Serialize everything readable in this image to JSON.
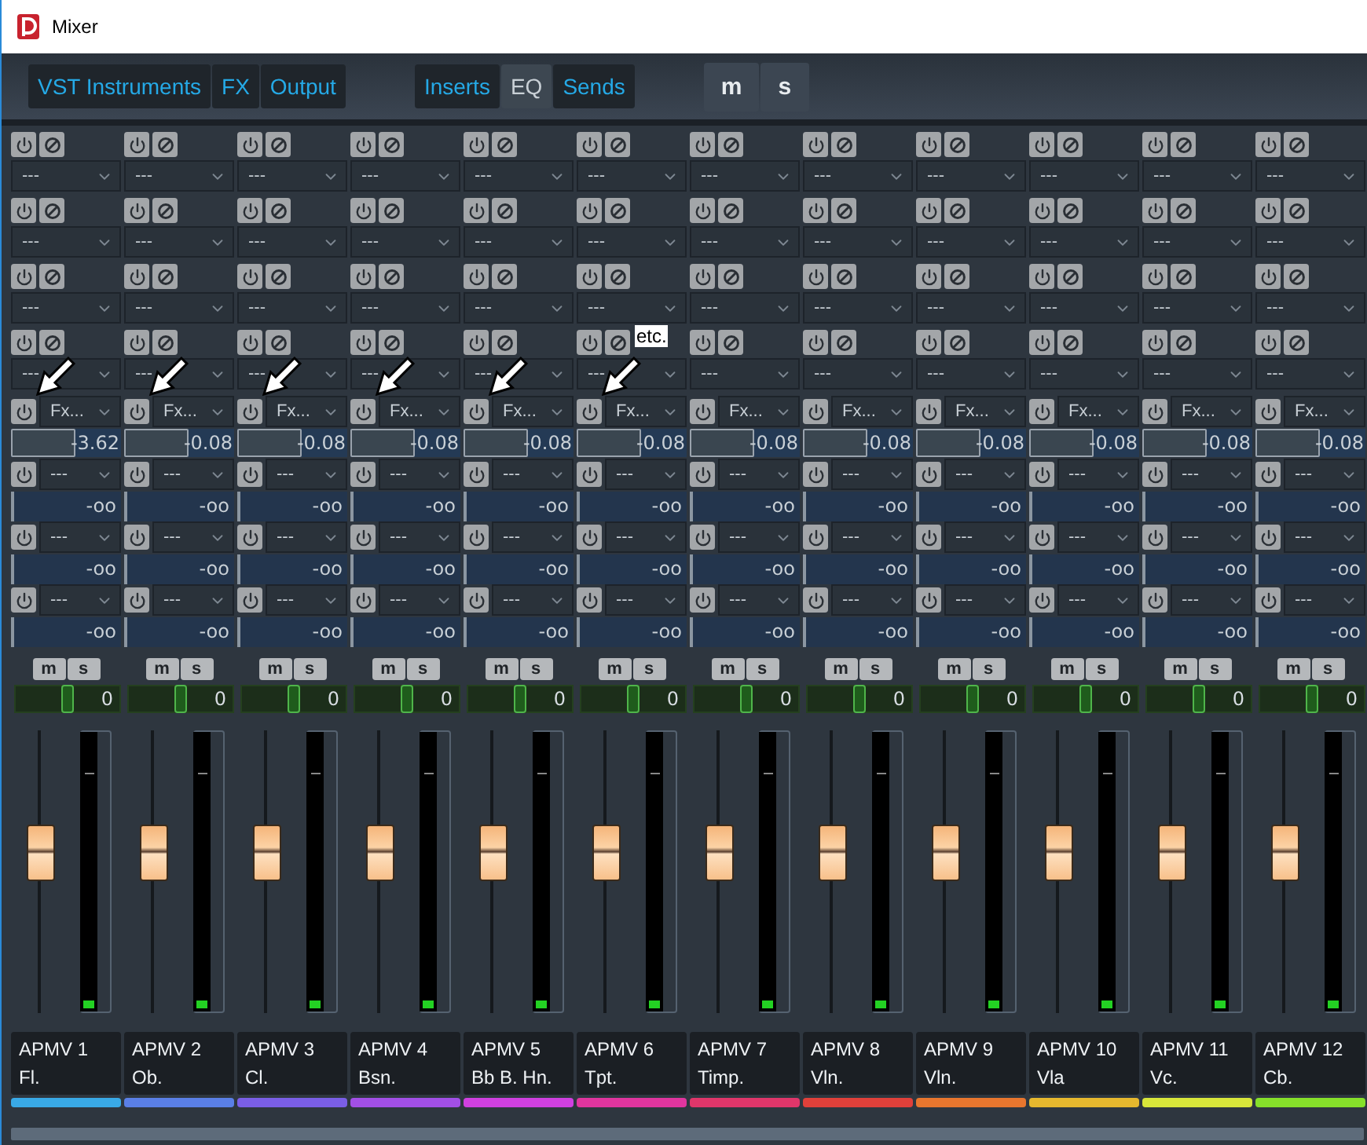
{
  "window": {
    "title": "Mixer"
  },
  "toolbar": {
    "groups": [
      [
        {
          "label": "VST Instruments",
          "selected": false
        },
        {
          "label": "FX",
          "selected": false
        },
        {
          "label": "Output",
          "selected": false
        }
      ],
      [
        {
          "label": "Inserts",
          "selected": false
        },
        {
          "label": "EQ",
          "selected": true
        },
        {
          "label": "Sends",
          "selected": false
        }
      ],
      [
        {
          "label": "m",
          "selected": false
        },
        {
          "label": "s",
          "selected": false
        }
      ]
    ]
  },
  "annotation": {
    "text": "etc."
  },
  "channels": [
    {
      "name": "APMV 1",
      "label": "Fl.",
      "color": "#39a9e6",
      "inserts": [
        "---",
        "---",
        "---",
        "---"
      ],
      "fx": "Fx...",
      "volume": {
        "value": "-3.62",
        "level": 0.58
      },
      "sends": [
        {
          "target": "---",
          "value": "-oo"
        },
        {
          "target": "---",
          "value": "-oo"
        },
        {
          "target": "---",
          "value": "-oo"
        }
      ],
      "buttons": [
        "m",
        "s"
      ],
      "pan": {
        "value": "0",
        "level": 0.5
      },
      "fader": {
        "level": 0.57
      },
      "meter": {
        "level": 0.03
      },
      "pointed": true
    },
    {
      "name": "APMV 2",
      "label": "Ob.",
      "color": "#5a7fe6",
      "inserts": [
        "---",
        "---",
        "---",
        "---"
      ],
      "fx": "Fx...",
      "volume": {
        "value": "-0.08",
        "level": 0.58
      },
      "sends": [
        {
          "target": "---",
          "value": "-oo"
        },
        {
          "target": "---",
          "value": "-oo"
        },
        {
          "target": "---",
          "value": "-oo"
        }
      ],
      "buttons": [
        "m",
        "s"
      ],
      "pan": {
        "value": "0",
        "level": 0.5
      },
      "fader": {
        "level": 0.57
      },
      "meter": {
        "level": 0.03
      },
      "pointed": true
    },
    {
      "name": "APMV 3",
      "label": "Cl.",
      "color": "#7a5ee6",
      "inserts": [
        "---",
        "---",
        "---",
        "---"
      ],
      "fx": "Fx...",
      "volume": {
        "value": "-0.08",
        "level": 0.58
      },
      "sends": [
        {
          "target": "---",
          "value": "-oo"
        },
        {
          "target": "---",
          "value": "-oo"
        },
        {
          "target": "---",
          "value": "-oo"
        }
      ],
      "buttons": [
        "m",
        "s"
      ],
      "pan": {
        "value": "0",
        "level": 0.5
      },
      "fader": {
        "level": 0.57
      },
      "meter": {
        "level": 0.03
      },
      "pointed": true
    },
    {
      "name": "APMV 4",
      "label": "Bsn.",
      "color": "#a24fe6",
      "inserts": [
        "---",
        "---",
        "---",
        "---"
      ],
      "fx": "Fx...",
      "volume": {
        "value": "-0.08",
        "level": 0.58
      },
      "sends": [
        {
          "target": "---",
          "value": "-oo"
        },
        {
          "target": "---",
          "value": "-oo"
        },
        {
          "target": "---",
          "value": "-oo"
        }
      ],
      "buttons": [
        "m",
        "s"
      ],
      "pan": {
        "value": "0",
        "level": 0.5
      },
      "fader": {
        "level": 0.57
      },
      "meter": {
        "level": 0.03
      },
      "pointed": true
    },
    {
      "name": "APMV 5",
      "label": "Bb B. Hn.",
      "color": "#d040e0",
      "inserts": [
        "---",
        "---",
        "---",
        "---"
      ],
      "fx": "Fx...",
      "volume": {
        "value": "-0.08",
        "level": 0.58
      },
      "sends": [
        {
          "target": "---",
          "value": "-oo"
        },
        {
          "target": "---",
          "value": "-oo"
        },
        {
          "target": "---",
          "value": "-oo"
        }
      ],
      "buttons": [
        "m",
        "s"
      ],
      "pan": {
        "value": "0",
        "level": 0.5
      },
      "fader": {
        "level": 0.57
      },
      "meter": {
        "level": 0.03
      },
      "pointed": true
    },
    {
      "name": "APMV 6",
      "label": "Tpt.",
      "color": "#e0359e",
      "inserts": [
        "---",
        "---",
        "---",
        "---"
      ],
      "fx": "Fx...",
      "volume": {
        "value": "-0.08",
        "level": 0.58
      },
      "sends": [
        {
          "target": "---",
          "value": "-oo"
        },
        {
          "target": "---",
          "value": "-oo"
        },
        {
          "target": "---",
          "value": "-oo"
        }
      ],
      "buttons": [
        "m",
        "s"
      ],
      "pan": {
        "value": "0",
        "level": 0.5
      },
      "fader": {
        "level": 0.57
      },
      "meter": {
        "level": 0.03
      },
      "pointed": true
    },
    {
      "name": "APMV 7",
      "label": "Timp.",
      "color": "#e0366a",
      "inserts": [
        "---",
        "---",
        "---",
        "---"
      ],
      "fx": "Fx...",
      "volume": {
        "value": "-0.08",
        "level": 0.58
      },
      "sends": [
        {
          "target": "---",
          "value": "-oo"
        },
        {
          "target": "---",
          "value": "-oo"
        },
        {
          "target": "---",
          "value": "-oo"
        }
      ],
      "buttons": [
        "m",
        "s"
      ],
      "pan": {
        "value": "0",
        "level": 0.5
      },
      "fader": {
        "level": 0.57
      },
      "meter": {
        "level": 0.03
      },
      "pointed": false
    },
    {
      "name": "APMV 8",
      "label": "Vln.",
      "color": "#e0403a",
      "inserts": [
        "---",
        "---",
        "---",
        "---"
      ],
      "fx": "Fx...",
      "volume": {
        "value": "-0.08",
        "level": 0.58
      },
      "sends": [
        {
          "target": "---",
          "value": "-oo"
        },
        {
          "target": "---",
          "value": "-oo"
        },
        {
          "target": "---",
          "value": "-oo"
        }
      ],
      "buttons": [
        "m",
        "s"
      ],
      "pan": {
        "value": "0",
        "level": 0.5
      },
      "fader": {
        "level": 0.57
      },
      "meter": {
        "level": 0.03
      },
      "pointed": false
    },
    {
      "name": "APMV 9",
      "label": "Vln.",
      "color": "#e8762e",
      "inserts": [
        "---",
        "---",
        "---",
        "---"
      ],
      "fx": "Fx...",
      "volume": {
        "value": "-0.08",
        "level": 0.58
      },
      "sends": [
        {
          "target": "---",
          "value": "-oo"
        },
        {
          "target": "---",
          "value": "-oo"
        },
        {
          "target": "---",
          "value": "-oo"
        }
      ],
      "buttons": [
        "m",
        "s"
      ],
      "pan": {
        "value": "0",
        "level": 0.5
      },
      "fader": {
        "level": 0.57
      },
      "meter": {
        "level": 0.03
      },
      "pointed": false
    },
    {
      "name": "APMV 10",
      "label": "Vla",
      "color": "#e6b82e",
      "inserts": [
        "---",
        "---",
        "---",
        "---"
      ],
      "fx": "Fx...",
      "volume": {
        "value": "-0.08",
        "level": 0.58
      },
      "sends": [
        {
          "target": "---",
          "value": "-oo"
        },
        {
          "target": "---",
          "value": "-oo"
        },
        {
          "target": "---",
          "value": "-oo"
        }
      ],
      "buttons": [
        "m",
        "s"
      ],
      "pan": {
        "value": "0",
        "level": 0.5
      },
      "fader": {
        "level": 0.57
      },
      "meter": {
        "level": 0.03
      },
      "pointed": false
    },
    {
      "name": "APMV 11",
      "label": "Vc.",
      "color": "#d8e63a",
      "inserts": [
        "---",
        "---",
        "---",
        "---"
      ],
      "fx": "Fx...",
      "volume": {
        "value": "-0.08",
        "level": 0.58
      },
      "sends": [
        {
          "target": "---",
          "value": "-oo"
        },
        {
          "target": "---",
          "value": "-oo"
        },
        {
          "target": "---",
          "value": "-oo"
        }
      ],
      "buttons": [
        "m",
        "s"
      ],
      "pan": {
        "value": "0",
        "level": 0.5
      },
      "fader": {
        "level": 0.57
      },
      "meter": {
        "level": 0.03
      },
      "pointed": false
    },
    {
      "name": "APMV 12",
      "label": "Cb.",
      "color": "#86e02a",
      "inserts": [
        "---",
        "---",
        "---",
        "---"
      ],
      "fx": "Fx...",
      "volume": {
        "value": "-0.08",
        "level": 0.58
      },
      "sends": [
        {
          "target": "---",
          "value": "-oo"
        },
        {
          "target": "---",
          "value": "-oo"
        },
        {
          "target": "---",
          "value": "-oo"
        }
      ],
      "buttons": [
        "m",
        "s"
      ],
      "pan": {
        "value": "0",
        "level": 0.5
      },
      "fader": {
        "level": 0.57
      },
      "meter": {
        "level": 0.03
      },
      "pointed": false
    }
  ]
}
